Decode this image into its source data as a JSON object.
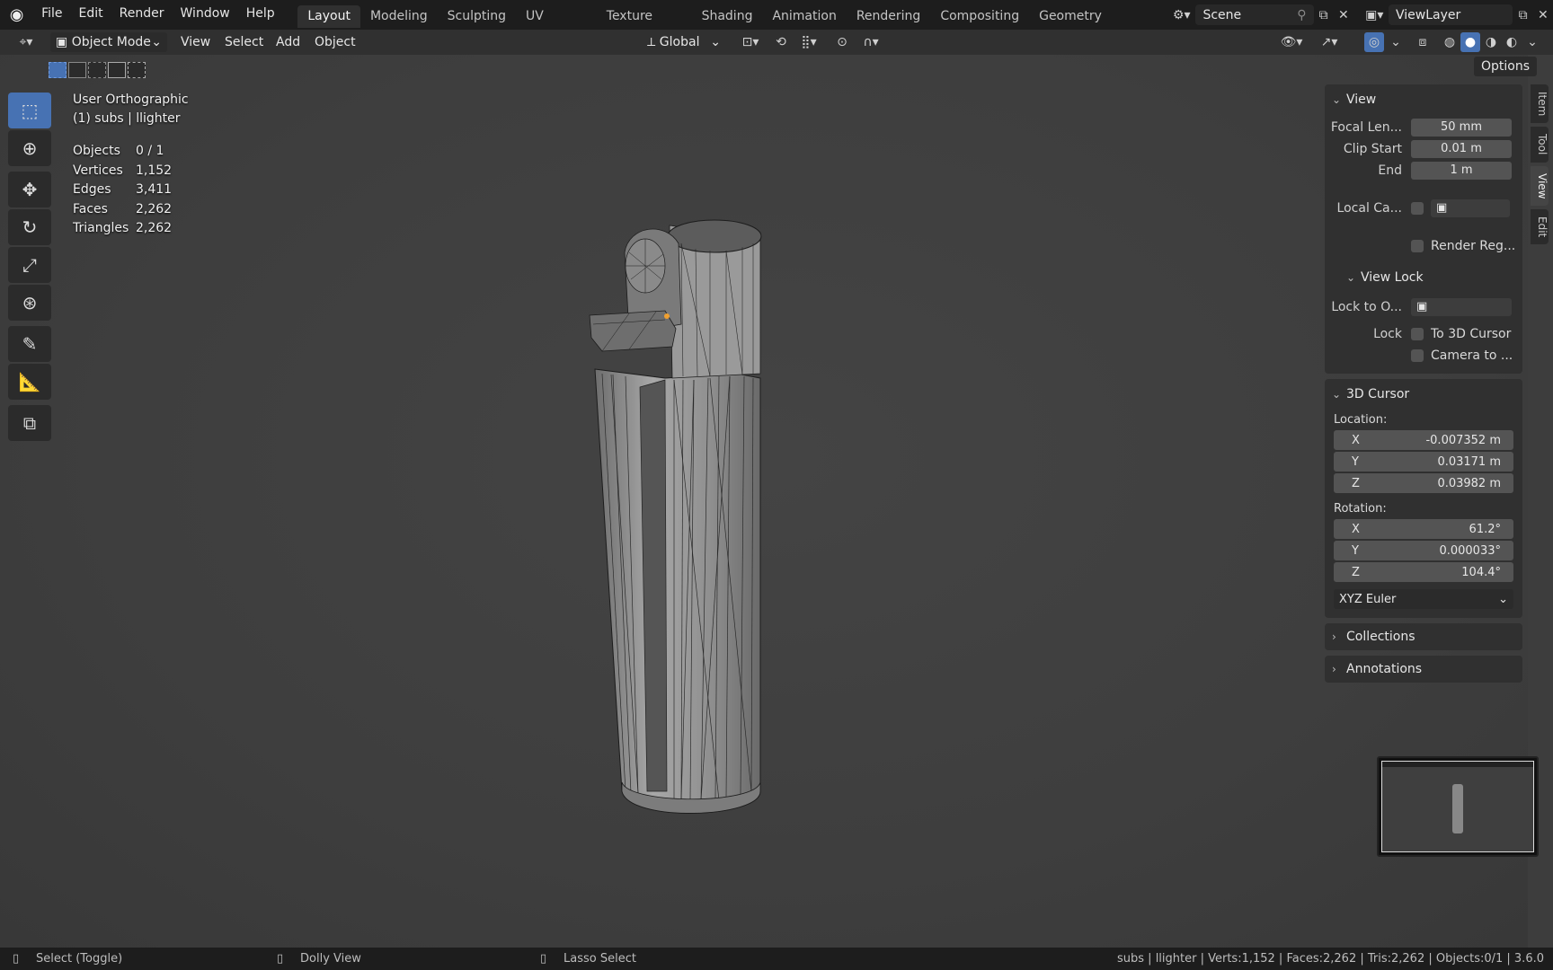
{
  "topbar": {
    "menus": [
      "File",
      "Edit",
      "Render",
      "Window",
      "Help"
    ],
    "workspaces": [
      "Layout",
      "Modeling",
      "Sculpting",
      "UV Editing",
      "Texture Paint",
      "Shading",
      "Animation",
      "Rendering",
      "Compositing",
      "Geometry Nodes"
    ],
    "scene": "Scene",
    "view_layer": "ViewLayer"
  },
  "header": {
    "mode": "Object Mode",
    "menus": [
      "View",
      "Select",
      "Add",
      "Object"
    ],
    "orientation": "Global",
    "options": "Options"
  },
  "overlay": {
    "view_name": "User Orthographic",
    "collection": "(1) subs | llighter",
    "stats": [
      {
        "label": "Objects",
        "value": "0 / 1"
      },
      {
        "label": "Vertices",
        "value": "1,152"
      },
      {
        "label": "Edges",
        "value": "3,411"
      },
      {
        "label": "Faces",
        "value": "2,262"
      },
      {
        "label": "Triangles",
        "value": "2,262"
      }
    ]
  },
  "npanel": {
    "view": {
      "title": "View",
      "focal_label": "Focal Len...",
      "focal_value": "50 mm",
      "clip_start_label": "Clip Start",
      "clip_start_value": "0.01 m",
      "end_label": "End",
      "end_value": "1 m",
      "local_cam_label": "Local Ca...",
      "render_region_label": "Render Reg..."
    },
    "view_lock": {
      "title": "View Lock",
      "lock_to_label": "Lock to O...",
      "lock_label": "Lock",
      "to_cursor_label": "To 3D Cursor",
      "camera_label": "Camera to ..."
    },
    "cursor": {
      "title": "3D Cursor",
      "location_label": "Location:",
      "loc": [
        {
          "axis": "X",
          "value": "-0.007352 m"
        },
        {
          "axis": "Y",
          "value": "0.03171 m"
        },
        {
          "axis": "Z",
          "value": "0.03982 m"
        }
      ],
      "rotation_label": "Rotation:",
      "rot": [
        {
          "axis": "X",
          "value": "61.2°"
        },
        {
          "axis": "Y",
          "value": "0.000033°"
        },
        {
          "axis": "Z",
          "value": "104.4°"
        }
      ],
      "rotation_mode": "XYZ Euler"
    },
    "collections_title": "Collections",
    "annotations_title": "Annotations"
  },
  "sidetabs": [
    "Item",
    "Tool",
    "View",
    "Edit"
  ],
  "statusbar": {
    "left1": "Select (Toggle)",
    "left2": "Dolly View",
    "left3": "Lasso Select",
    "right": "subs | llighter | Verts:1,152 | Faces:2,262 | Tris:2,262 | Objects:0/1 | 3.6.0"
  },
  "colors": {
    "accent": "#4772b3",
    "object_gray": "#8e8e8e"
  }
}
